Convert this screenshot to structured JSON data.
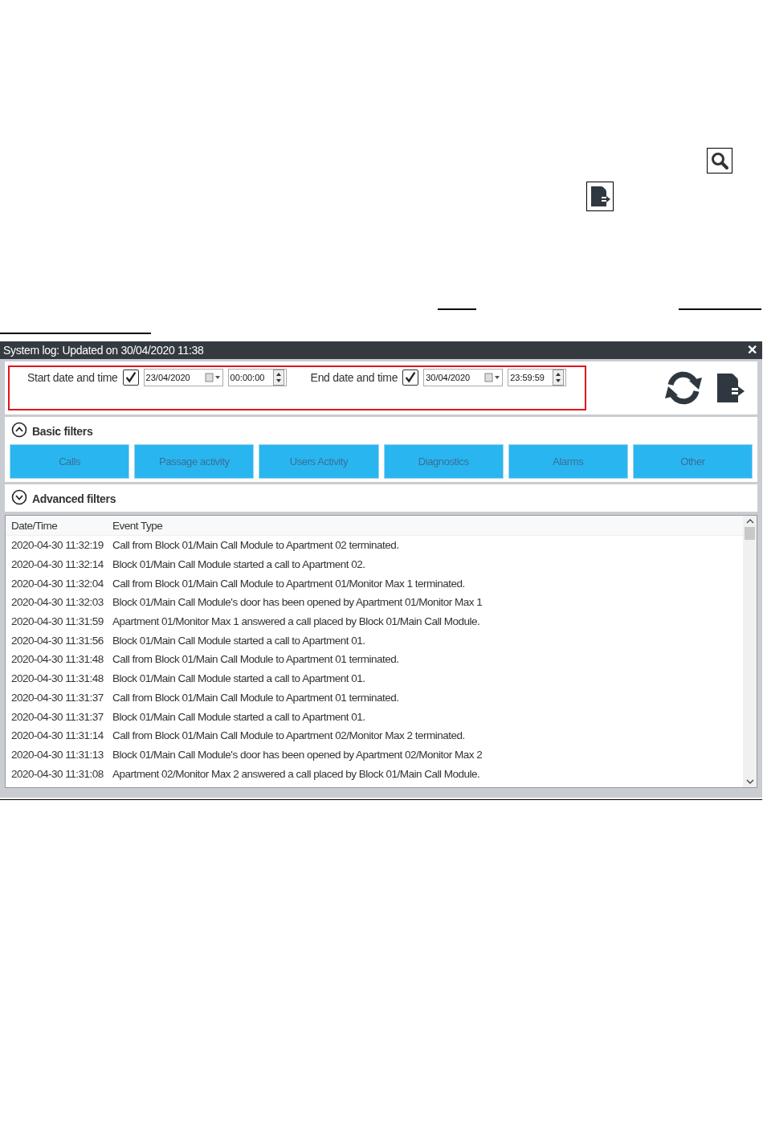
{
  "window": {
    "title": "System log: Updated on 30/04/2020 11:38",
    "close": "✕"
  },
  "date_filters": [
    {
      "label": "Start date and time",
      "checked": true,
      "date": "23/04/2020",
      "time": "00:00:00"
    },
    {
      "label": "End date and time",
      "checked": true,
      "date": "30/04/2020",
      "time": "23:59:59"
    }
  ],
  "basic_filters": {
    "title": "Basic filters",
    "expanded": true,
    "buttons": [
      "Calls",
      "Passage activity",
      "Users Activity",
      "Diagnostics",
      "Alarms",
      "Other"
    ]
  },
  "advanced_filters": {
    "title": "Advanced filters",
    "expanded": false
  },
  "table": {
    "columns": [
      "Date/Time",
      "Event Type"
    ],
    "rows": [
      [
        "2020-04-30 11:32:19",
        "Call from Block 01/Main Call Module to Apartment 02 terminated."
      ],
      [
        "2020-04-30 11:32:14",
        "Block 01/Main Call Module started a call to Apartment 02."
      ],
      [
        "2020-04-30 11:32:04",
        "Call from Block 01/Main Call Module to Apartment 01/Monitor Max 1 terminated."
      ],
      [
        "2020-04-30 11:32:03",
        "Block 01/Main Call Module's door has been opened by Apartment 01/Monitor Max 1"
      ],
      [
        "2020-04-30 11:31:59",
        "Apartment 01/Monitor Max 1 answered a call placed by Block 01/Main Call Module."
      ],
      [
        "2020-04-30 11:31:56",
        "Block 01/Main Call Module started a call to Apartment 01."
      ],
      [
        "2020-04-30 11:31:48",
        "Call from Block 01/Main Call Module to Apartment 01 terminated."
      ],
      [
        "2020-04-30 11:31:48",
        "Block 01/Main Call Module started a call to Apartment 01."
      ],
      [
        "2020-04-30 11:31:37",
        "Call from Block 01/Main Call Module to Apartment 01 terminated."
      ],
      [
        "2020-04-30 11:31:37",
        "Block 01/Main Call Module started a call to Apartment 01."
      ],
      [
        "2020-04-30 11:31:14",
        "Call from Block 01/Main Call Module to Apartment 02/Monitor Max 2 terminated."
      ],
      [
        "2020-04-30 11:31:13",
        "Block 01/Main Call Module's door has been opened by Apartment 02/Monitor Max 2"
      ],
      [
        "2020-04-30 11:31:08",
        "Apartment 02/Monitor Max 2 answered a call placed by Block 01/Main Call Module."
      ]
    ]
  }
}
